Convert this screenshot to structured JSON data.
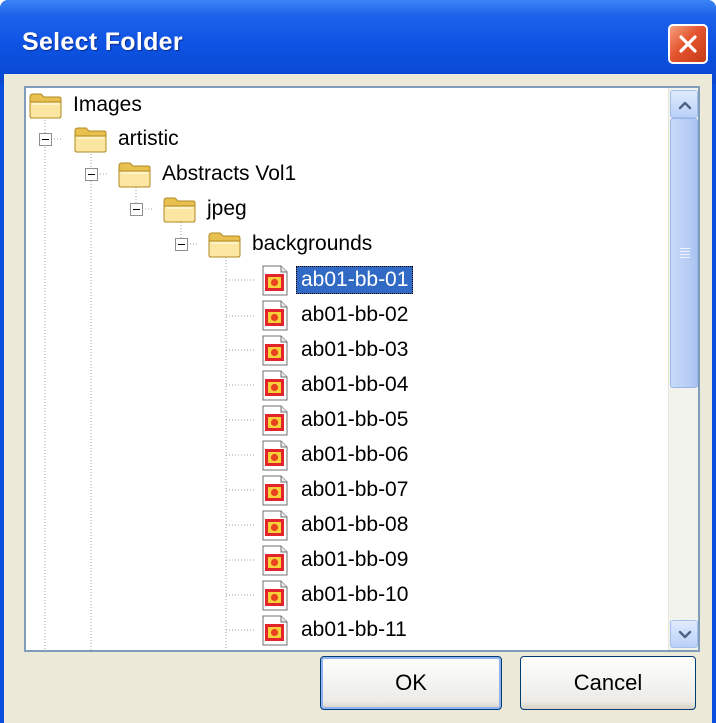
{
  "window": {
    "title": "Select Folder"
  },
  "tree": {
    "folders": [
      {
        "label": "Images"
      },
      {
        "label": "artistic"
      },
      {
        "label": "Abstracts Vol1"
      },
      {
        "label": "jpeg"
      },
      {
        "label": "backgrounds"
      }
    ],
    "files": [
      "ab01-bb-01",
      "ab01-bb-02",
      "ab01-bb-03",
      "ab01-bb-04",
      "ab01-bb-05",
      "ab01-bb-06",
      "ab01-bb-07",
      "ab01-bb-08",
      "ab01-bb-09",
      "ab01-bb-10",
      "ab01-bb-11"
    ],
    "selected": "ab01-bb-01"
  },
  "buttons": {
    "ok": "OK",
    "cancel": "Cancel"
  },
  "icons": {
    "folder": "folder-icon",
    "file": "image-file-icon",
    "close": "close-icon",
    "scroll_up": "chevron-up-icon",
    "scroll_down": "chevron-down-icon"
  },
  "colors": {
    "titlebar": "#0a4ee0",
    "selection": "#316ac5",
    "close_button": "#e4552e"
  }
}
